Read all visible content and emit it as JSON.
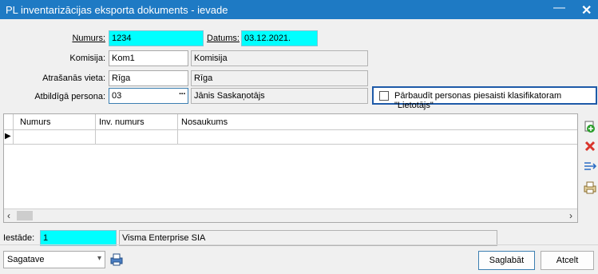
{
  "window": {
    "title": "PL inventarizācijas eksporta dokuments - ievade"
  },
  "form": {
    "numurs_label": "Numurs:",
    "numurs_value": "1234",
    "datums_label": "Datums:",
    "datums_value": "03.12.2021.",
    "komisija_label": "Komisija:",
    "komisija_code": "Kom1",
    "komisija_name": "Komisija",
    "atrasanas_label": "Atrašanās vieta:",
    "atrasanas_code": "Rīga",
    "atrasanas_name": "Rīga",
    "atbildiga_label": "Atbildīgā persona:",
    "atbildiga_code": "03",
    "atbildiga_lookup": "···",
    "atbildiga_name": "Jānis Saskaņotājs",
    "check_label": "Pārbaudīt personas piesaisti klasifikatoram \"Lietotājs\""
  },
  "grid": {
    "columns": [
      "Numurs",
      "Inv. numurs",
      "Nosaukums"
    ],
    "row_indicator": "▶"
  },
  "footer": {
    "iestade_label": "Iestāde:",
    "iestade_code": "1",
    "iestade_name": "Visma Enterprise SIA",
    "status_value": "Sagatave",
    "save_label": "Saglabāt",
    "cancel_label": "Atcelt"
  },
  "icons": {
    "minimize": "—",
    "close": "✕",
    "add_row": "add-row-icon",
    "delete_row": "delete-row-icon",
    "import": "import-icon",
    "print_row": "print-row-icon",
    "printer": "printer-icon"
  },
  "colors": {
    "titlebar": "#1e7ac4",
    "required_field": "#00ffff",
    "highlight_border": "#1e5aa8"
  }
}
